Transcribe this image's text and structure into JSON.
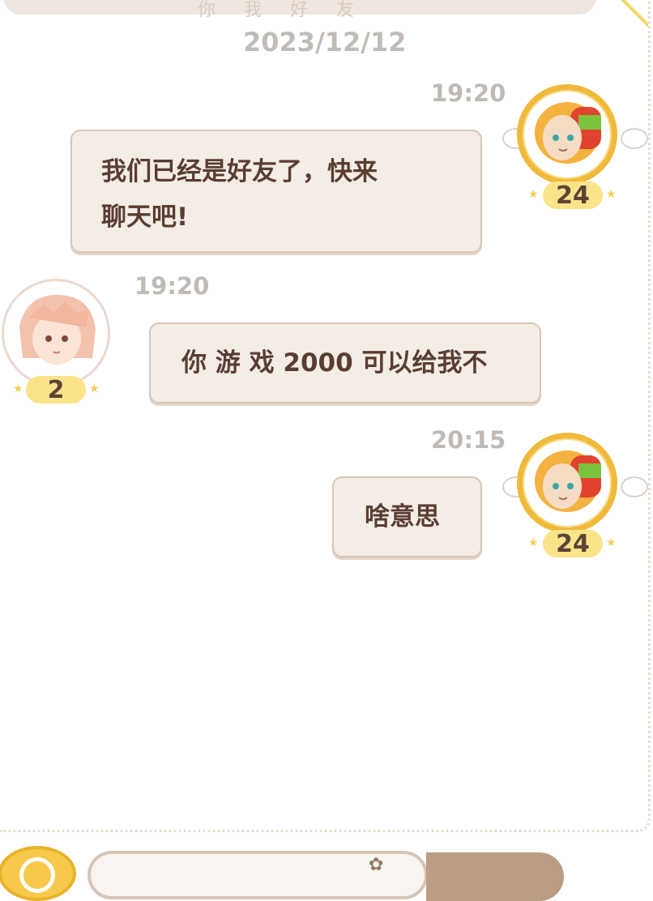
{
  "header": {
    "title_partial": "你 我 好 友"
  },
  "chat": {
    "date": "2023/12/12",
    "messages": [
      {
        "sender": "self",
        "time": "19:20",
        "text_line1": "我们已经是好友了，快来",
        "text_line2": "聊天吧!",
        "level": "24"
      },
      {
        "sender": "friend",
        "time": "19:20",
        "text": "你 游 戏 2000 可以给我不",
        "level": "2"
      },
      {
        "sender": "self",
        "time": "20:15",
        "text": "啥意思",
        "level": "24"
      }
    ]
  },
  "colors": {
    "bubble_bg": "#f3ede6",
    "bubble_border": "#d8c5b5",
    "text": "#5a3d31",
    "timestamp": "#bfbab4",
    "gold_ring": "#f0b93a",
    "level_badge": "#fbe38a"
  },
  "icons": {
    "emoji": "flower-icon",
    "bottom_left": "search-icon"
  }
}
